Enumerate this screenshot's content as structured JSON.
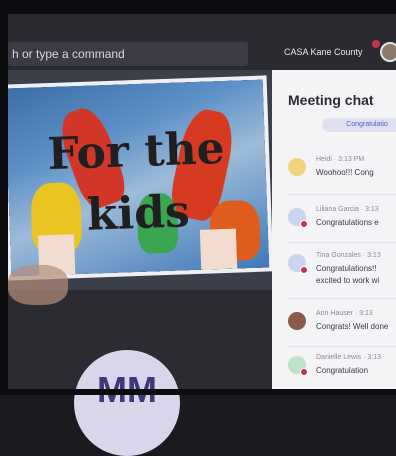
{
  "header": {
    "search_placeholder": "h or type a command",
    "org_name": "CASA Kane County"
  },
  "shared_screen": {
    "poster_line1": "For the",
    "poster_line2": "kids"
  },
  "participant": {
    "initials": "MM"
  },
  "chat": {
    "title": "Meeting chat",
    "pill": "Congratulatio",
    "messages": [
      {
        "name": "Heidi  ·  3:13 PM",
        "text": "Woohoo!!! Cong",
        "avatar_color": "#f3d37a"
      },
      {
        "name": "Liliana Garcia  ·  3:13",
        "text": "Congratulations e",
        "avatar_color": "#c9d4f0"
      },
      {
        "name": "Tina Gonzales  ·  3:13",
        "text": "Congratulations!!",
        "text2": "excited to work wi",
        "avatar_color": "#c9d4f0"
      },
      {
        "name": "Ann Hauser  ·  3:13",
        "text": "Congrats! Well done",
        "avatar_color": "#8a5a4a"
      },
      {
        "name": "Danielle Lewis  ·  3:13",
        "text": "Congratulation",
        "avatar_color": "#bfe3c6"
      }
    ]
  }
}
